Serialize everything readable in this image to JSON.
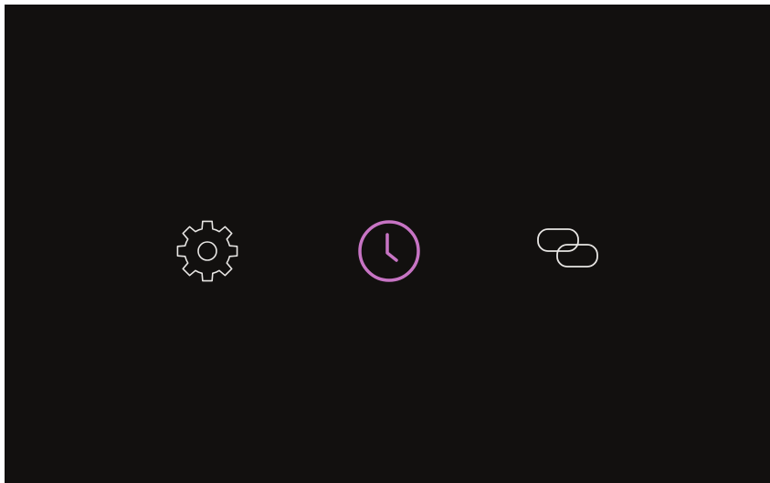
{
  "colors": {
    "background": "#12100f",
    "icon_default": "#e8e6e4",
    "icon_active": "#c774c4"
  },
  "icons": [
    {
      "id": "settings",
      "icon": "gear-icon",
      "active": false
    },
    {
      "id": "clock",
      "icon": "clock-icon",
      "active": true
    },
    {
      "id": "link",
      "icon": "link-icon",
      "active": false
    }
  ]
}
